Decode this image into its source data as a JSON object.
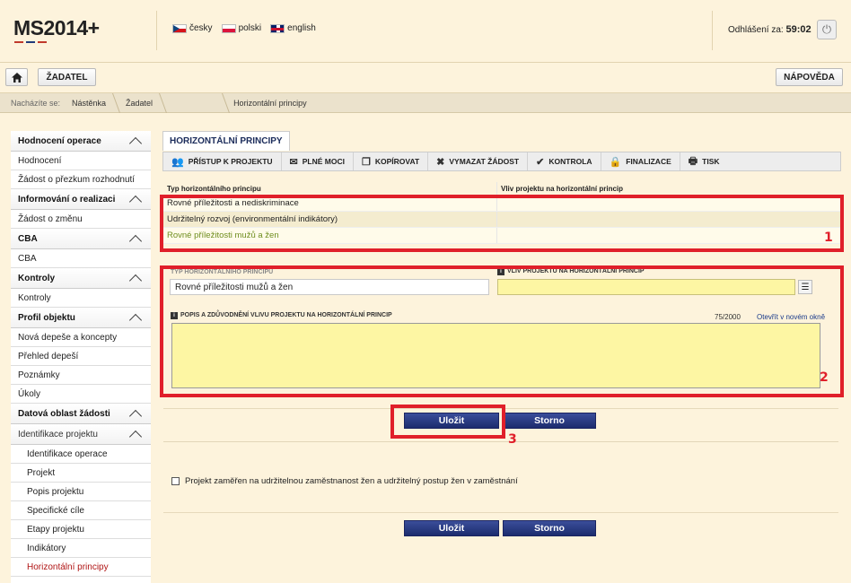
{
  "header": {
    "logo_text": "MS2014",
    "logo_plus": "+",
    "logo_colors": [
      "#c0392b",
      "#1f3a7a",
      "#c0392b"
    ],
    "languages": [
      {
        "flag": "flag-cz",
        "label": "česky"
      },
      {
        "flag": "flag-pl",
        "label": "polski"
      },
      {
        "flag": "flag-gb",
        "label": "english"
      }
    ],
    "logout_label": "Odhlášení za:",
    "logout_time": "59:02",
    "power_icon": "power-icon"
  },
  "nav": {
    "home_icon": "home-icon",
    "applicant_label": "ŽADATEL",
    "help_label": "NÁPOVĚDA"
  },
  "breadcrumb": {
    "prefix": "Nacházíte se:",
    "items": [
      "Nástěnka",
      "Žadatel",
      "",
      "Horizontální principy"
    ]
  },
  "sidebar": {
    "sections": [
      {
        "title": "Hodnocení operace",
        "items": [
          "Hodnocení",
          "Žádost o přezkum rozhodnutí"
        ]
      },
      {
        "title": "Informování o realizaci",
        "items": [
          "Žádost o změnu"
        ]
      },
      {
        "title": "CBA",
        "items": [
          "CBA"
        ]
      },
      {
        "title": "Kontroly",
        "items": [
          "Kontroly"
        ]
      },
      {
        "title": "Profil objektu",
        "items": [
          "Nová depeše a koncepty",
          "Přehled depeší",
          "Poznámky",
          "Úkoly"
        ]
      },
      {
        "title": "Datová oblast žádosti",
        "items": []
      },
      {
        "title": "Identifikace projektu",
        "items": [
          "Identifikace operace",
          "Projekt",
          "Popis projektu",
          "Specifické cíle",
          "Etapy projektu",
          "Indikátory",
          "Horizontální principy"
        ]
      }
    ]
  },
  "main": {
    "tab_label": "HORIZONTÁLNÍ PRINCIPY",
    "toolbar": [
      {
        "icon": "people-icon",
        "glyph": "👥",
        "label": "PŘÍSTUP K PROJEKTU"
      },
      {
        "icon": "envelope-icon",
        "glyph": "✉",
        "label": "PLNÉ MOCI"
      },
      {
        "icon": "copy-icon",
        "glyph": "❐",
        "label": "KOPÍROVAT"
      },
      {
        "icon": "close-icon",
        "glyph": "✖",
        "label": "VYMAZAT ŽÁDOST"
      },
      {
        "icon": "checkmark-icon",
        "glyph": "✔",
        "label": "KONTROLA"
      },
      {
        "icon": "lock-icon",
        "glyph": "🔒",
        "label": "FINALIZACE"
      },
      {
        "icon": "print-icon",
        "glyph": "🖶",
        "label": "TISK"
      }
    ],
    "table": {
      "columns": [
        "Typ horizontálního principu",
        "Vliv projektu na horizontální princip"
      ],
      "rows": [
        [
          "Rovné příležitosti a nediskriminace",
          ""
        ],
        [
          "Udržitelný rozvoj (environmentální indikátory)",
          ""
        ],
        [
          "Rovné příležitosti mužů a žen",
          ""
        ]
      ],
      "selected_row": 2
    },
    "form": {
      "type_label": "TYP HORIZONTÁLNÍHO PRINCIPU",
      "type_value": "Rovné příležitosti mužů a žen",
      "impact_label": "VLIV PROJEKTU NA HORIZONTÁLNÍ PRINCIP",
      "impact_value": "",
      "description_label": "POPIS A ZDŮVODNĚNÍ VLIVU PROJEKTU NA HORIZONTÁLNÍ PRINCIP",
      "description_value": "",
      "counter": "75/2000",
      "open_new_window": "Otevřít v novém okně"
    },
    "buttons": {
      "save": "Uložit",
      "cancel": "Storno"
    },
    "checkbox_label": "Projekt zaměřen na udržitelnou zaměstnanost žen a udržitelný postup žen v zaměstnání",
    "checkbox_checked": false,
    "annotations": [
      "1",
      "2",
      "3"
    ],
    "annotation_color": "#e01f2a"
  }
}
